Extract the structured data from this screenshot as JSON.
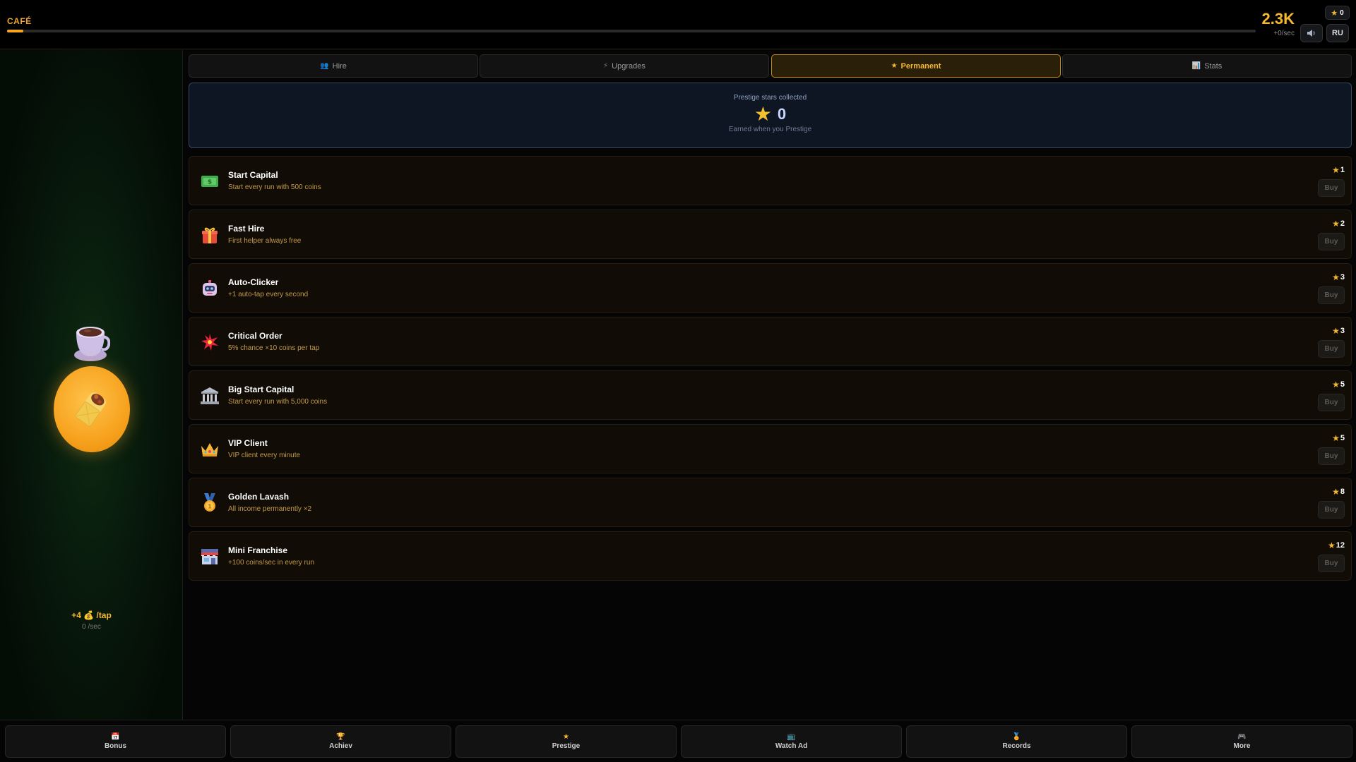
{
  "header": {
    "brand": "CAFÉ",
    "coins": "2.3K",
    "per_sec": "+0/sec",
    "stars": "0",
    "language": "RU",
    "level_progress": 0.013,
    "accent_color": "#f5a623"
  },
  "left": {
    "tap_rate": "+4 💰 /tap",
    "idle_rate": "0 /sec"
  },
  "tabs": [
    {
      "label": "Hire",
      "icon": "people-icon",
      "active": false
    },
    {
      "label": "Upgrades",
      "icon": "lightning-icon",
      "active": false
    },
    {
      "label": "Permanent",
      "icon": "star-icon",
      "active": true
    },
    {
      "label": "Stats",
      "icon": "chart-icon",
      "active": false
    }
  ],
  "prestige": {
    "title": "Prestige stars collected",
    "value": "0",
    "subtitle": "Earned when you Prestige"
  },
  "upgrades": [
    {
      "name": "Start Capital",
      "desc": "Start every run with 500 coins",
      "cost": "1",
      "icon": "money-icon",
      "buy": "Buy"
    },
    {
      "name": "Fast Hire",
      "desc": "First helper always free",
      "cost": "2",
      "icon": "gift-icon",
      "buy": "Buy"
    },
    {
      "name": "Auto-Clicker",
      "desc": "+1 auto-tap every second",
      "cost": "3",
      "icon": "robot-icon",
      "buy": "Buy"
    },
    {
      "name": "Critical Order",
      "desc": "5% chance ×10 coins per tap",
      "cost": "3",
      "icon": "burst-icon",
      "buy": "Buy"
    },
    {
      "name": "Big Start Capital",
      "desc": "Start every run with 5,000 coins",
      "cost": "5",
      "icon": "bank-icon",
      "buy": "Buy"
    },
    {
      "name": "VIP Client",
      "desc": "VIP client every minute",
      "cost": "5",
      "icon": "crown-icon",
      "buy": "Buy"
    },
    {
      "name": "Golden Lavash",
      "desc": "All income permanently ×2",
      "cost": "8",
      "icon": "medal-icon",
      "buy": "Buy"
    },
    {
      "name": "Mini Franchise",
      "desc": "+100 coins/sec in every run",
      "cost": "12",
      "icon": "store-icon",
      "buy": "Buy"
    }
  ],
  "bottom_nav": [
    {
      "label": "Bonus",
      "icon": "calendar-icon"
    },
    {
      "label": "Achiev",
      "icon": "trophy-icon"
    },
    {
      "label": "Prestige",
      "icon": "star-icon"
    },
    {
      "label": "Watch Ad",
      "icon": "tv-icon"
    },
    {
      "label": "Records",
      "icon": "medal-icon"
    },
    {
      "label": "More",
      "icon": "gamepad-icon"
    }
  ]
}
